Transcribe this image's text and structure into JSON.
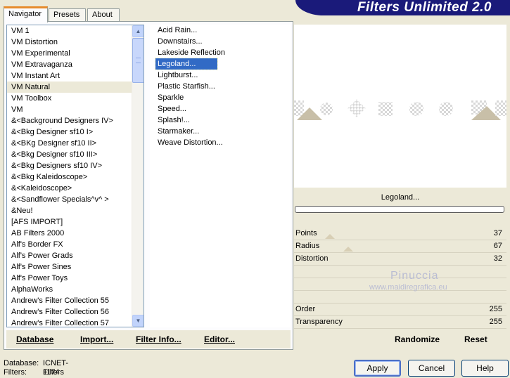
{
  "tabs": [
    "Navigator",
    "Presets",
    "About"
  ],
  "banner": {
    "title": "Filters Unlimited 2.0"
  },
  "categories": {
    "items": [
      "VM 1",
      "VM Distortion",
      "VM Experimental",
      "VM Extravaganza",
      "VM Instant Art",
      "VM Natural",
      "VM Toolbox",
      "VM",
      "&<Background Designers IV>",
      "&<Bkg Designer sf10 I>",
      "&<BKg Designer sf10 II>",
      "&<Bkg Designer sf10 III>",
      "&<Bkg Designers sf10 IV>",
      "&<Bkg Kaleidoscope>",
      "&<Kaleidoscope>",
      "&<Sandflower Specials^v^ >",
      "&Neu!",
      "[AFS IMPORT]",
      "AB Filters 2000",
      "Alf's Border FX",
      "Alf's Power Grads",
      "Alf's Power Sines",
      "Alf's Power Toys",
      "AlphaWorks",
      "Andrew's Filter Collection 55",
      "Andrew's Filter Collection 56",
      "Andrew's Filter Collection 57"
    ],
    "selected": "VM Natural"
  },
  "filters": {
    "items": [
      "Acid Rain...",
      "Downstairs...",
      "Lakeside Reflection",
      "Legoland...",
      "Lightburst...",
      "Plastic Starfish...",
      "Sparkle",
      "Speed...",
      "Splash!...",
      "Starmaker...",
      "Weave Distortion..."
    ],
    "selected": "Legoland..."
  },
  "left_buttons": {
    "database": "Database",
    "import": "Import...",
    "filter_info": "Filter Info...",
    "editor": "Editor..."
  },
  "preview": {
    "filter_name": "Legoland..."
  },
  "params": [
    {
      "label": "Points",
      "value": "37"
    },
    {
      "label": "Radius",
      "value": "67"
    },
    {
      "label": "Distortion",
      "value": "32"
    },
    {
      "label": "",
      "value": ""
    },
    {
      "label": "",
      "value": ""
    },
    {
      "label": "",
      "value": ""
    },
    {
      "label": "Order",
      "value": "255"
    },
    {
      "label": "Transparency",
      "value": "255"
    }
  ],
  "watermark": {
    "line1": "Pinuccia",
    "line2": "www.maidiregrafica.eu"
  },
  "right_buttons": {
    "randomize": "Randomize",
    "reset": "Reset"
  },
  "status": {
    "database_label": "Database:",
    "database_value": "ICNET-Filters",
    "filters_label": "Filters:",
    "filters_value": "1174"
  },
  "dialog_buttons": {
    "apply": "Apply",
    "cancel": "Cancel",
    "help": "Help"
  }
}
